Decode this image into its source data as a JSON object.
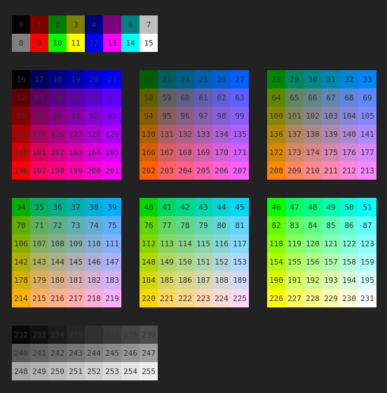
{
  "basic": {
    "labels": [
      "0",
      "1",
      "2",
      "3",
      "4",
      "5",
      "6",
      "7",
      "8",
      "9",
      "10",
      "11",
      "12",
      "13",
      "14",
      "15"
    ],
    "colors": [
      "#000000",
      "#800000",
      "#008000",
      "#808000",
      "#000080",
      "#800080",
      "#008080",
      "#c0c0c0",
      "#808080",
      "#ff0000",
      "#00ff00",
      "#ffff00",
      "#0000ff",
      "#ff00ff",
      "#00ffff",
      "#ffffff"
    ]
  },
  "cube": {
    "first_index": 16,
    "last_index": 231,
    "levels": [
      "#00",
      "#5f",
      "#87",
      "#af",
      "#d7",
      "#ff"
    ]
  },
  "grayscale": {
    "first_index": 232,
    "last_index": 255
  },
  "text_color": "#333333"
}
